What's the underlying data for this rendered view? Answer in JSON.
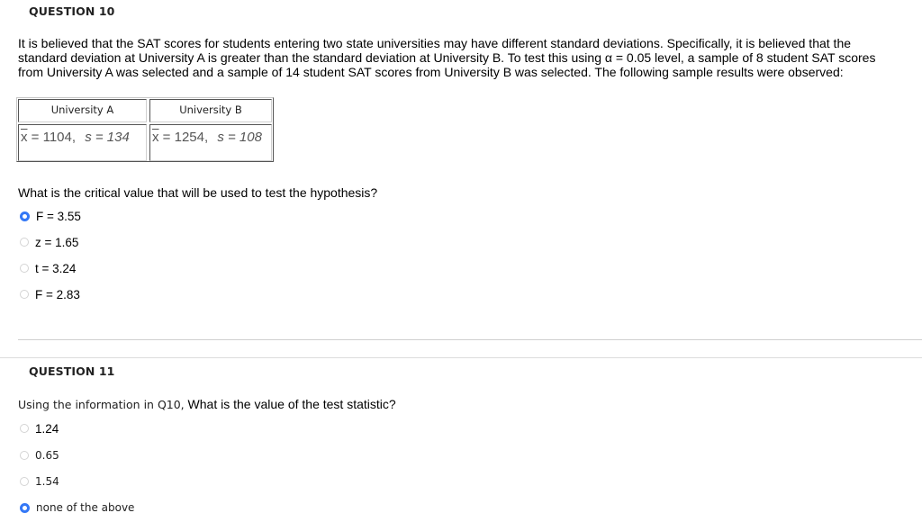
{
  "q10": {
    "title": "QUESTION 10",
    "text": "It is believed that the SAT scores for students entering two state universities may have different standard deviations.  Specifically, it is believed that the standard deviation at University A is greater than the standard deviation at University B.   To test this using α = 0.05 level, a sample of 8 student SAT scores from University A was selected and a sample of 14 student SAT scores from University B was selected.  The following sample results were observed:",
    "table": {
      "headers": [
        "University A",
        "University B"
      ],
      "rows": [
        {
          "xbar_symbol": "x",
          "mean": "= 1104,",
          "s": "s = 134"
        },
        {
          "xbar_symbol": "x",
          "mean": "= 1254,",
          "s": "s = 108"
        }
      ]
    },
    "prompt": "What is the critical value that will be used to test the hypothesis?",
    "options": [
      {
        "label": "F = 3.55",
        "selected": true
      },
      {
        "label": "z = 1.65",
        "selected": false
      },
      {
        "label": "t = 3.24",
        "selected": false
      },
      {
        "label": "F = 2.83",
        "selected": false
      }
    ]
  },
  "q11": {
    "title": "QUESTION 11",
    "prompt_lead": "Using the information in Q10,",
    "prompt": " What is the value of the test statistic?",
    "options": [
      {
        "label": "1.24",
        "selected": false
      },
      {
        "label": "0.65",
        "selected": false
      },
      {
        "label": "1.54",
        "selected": false
      },
      {
        "label": "none of the above",
        "selected": true
      }
    ]
  },
  "colors": {
    "radio_selected": "#3478f6",
    "radio_unselected_border": "#d4d4d4",
    "divider": "#cfcfcf"
  }
}
